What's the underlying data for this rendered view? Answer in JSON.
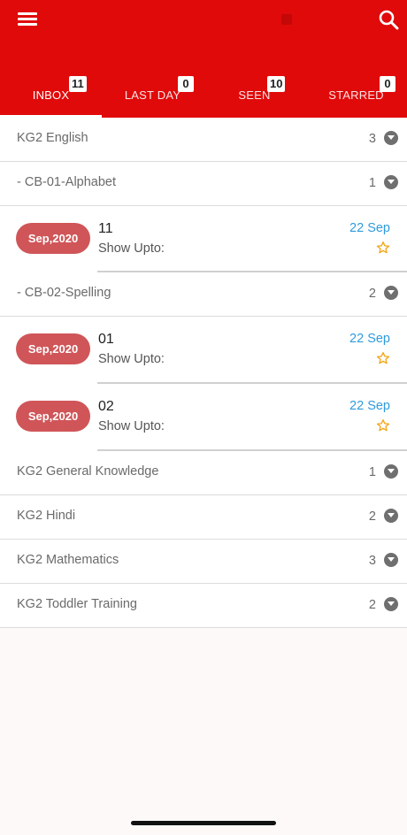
{
  "tabs": [
    {
      "label": "INBOX",
      "count": "11"
    },
    {
      "label": "LAST DAY",
      "count": "0"
    },
    {
      "label": "SEEN",
      "count": "10"
    },
    {
      "label": "STARRED",
      "count": "0"
    }
  ],
  "groups": [
    {
      "title": "KG2 English",
      "count": "3"
    },
    {
      "title": "- CB-01-Alphabet",
      "count": "1"
    },
    {
      "title": "- CB-02-Spelling",
      "count": "2"
    },
    {
      "title": "KG2 General Knowledge",
      "count": "1"
    },
    {
      "title": "KG2 Hindi",
      "count": "2"
    },
    {
      "title": "KG2 Mathematics",
      "count": "3"
    },
    {
      "title": "KG2 Toddler Training",
      "count": "2"
    }
  ],
  "messages": [
    {
      "badge": "Sep,2020",
      "title": "11",
      "subtitle": "Show Upto:",
      "date": "22 Sep"
    },
    {
      "badge": "Sep,2020",
      "title": "01",
      "subtitle": "Show Upto:",
      "date": "22 Sep"
    },
    {
      "badge": "Sep,2020",
      "title": "02",
      "subtitle": "Show Upto:",
      "date": "22 Sep"
    }
  ],
  "colors": {
    "appbar": "#e00a0a",
    "badge": "#cf5558",
    "date": "#2f9bdc",
    "star": "#f2a516"
  }
}
